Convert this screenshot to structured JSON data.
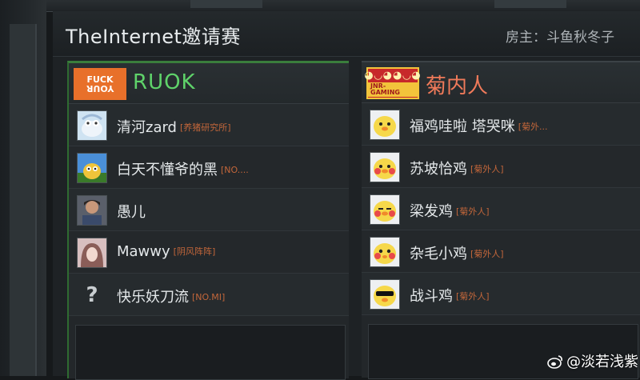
{
  "lobby": {
    "title": "TheInternet邀请赛",
    "host": "房主：斗鱼秋冬子"
  },
  "teams": [
    {
      "name": "RUOK",
      "logo_text": "FUCK",
      "logo_text_flipped": "YOUR",
      "color": "#5fd36a",
      "players": [
        {
          "name": "清河zard",
          "tag": "[养猪研究所]"
        },
        {
          "name": "白天不懂爷的黑",
          "tag": "[NO...."
        },
        {
          "name": "愚儿",
          "tag": ""
        },
        {
          "name": "Mawwy",
          "tag": "[阴风阵阵]"
        },
        {
          "name": "快乐妖刀流",
          "tag": "[NO.MI]",
          "avatar": "?"
        }
      ]
    },
    {
      "name": "菊内人",
      "logo_text": "JNR-GAMING",
      "color": "#f07a5a",
      "players": [
        {
          "name": "福鸡哇啦 塔哭咪",
          "tag": "[菊外..."
        },
        {
          "name": "苏坡恰鸡",
          "tag": "[菊外人]"
        },
        {
          "name": "梁发鸡",
          "tag": "[菊外人]"
        },
        {
          "name": "杂毛小鸡",
          "tag": "[菊外人]"
        },
        {
          "name": "战斗鸡",
          "tag": "[菊外人]"
        }
      ]
    }
  ],
  "watermark": "@淡若浅紫"
}
